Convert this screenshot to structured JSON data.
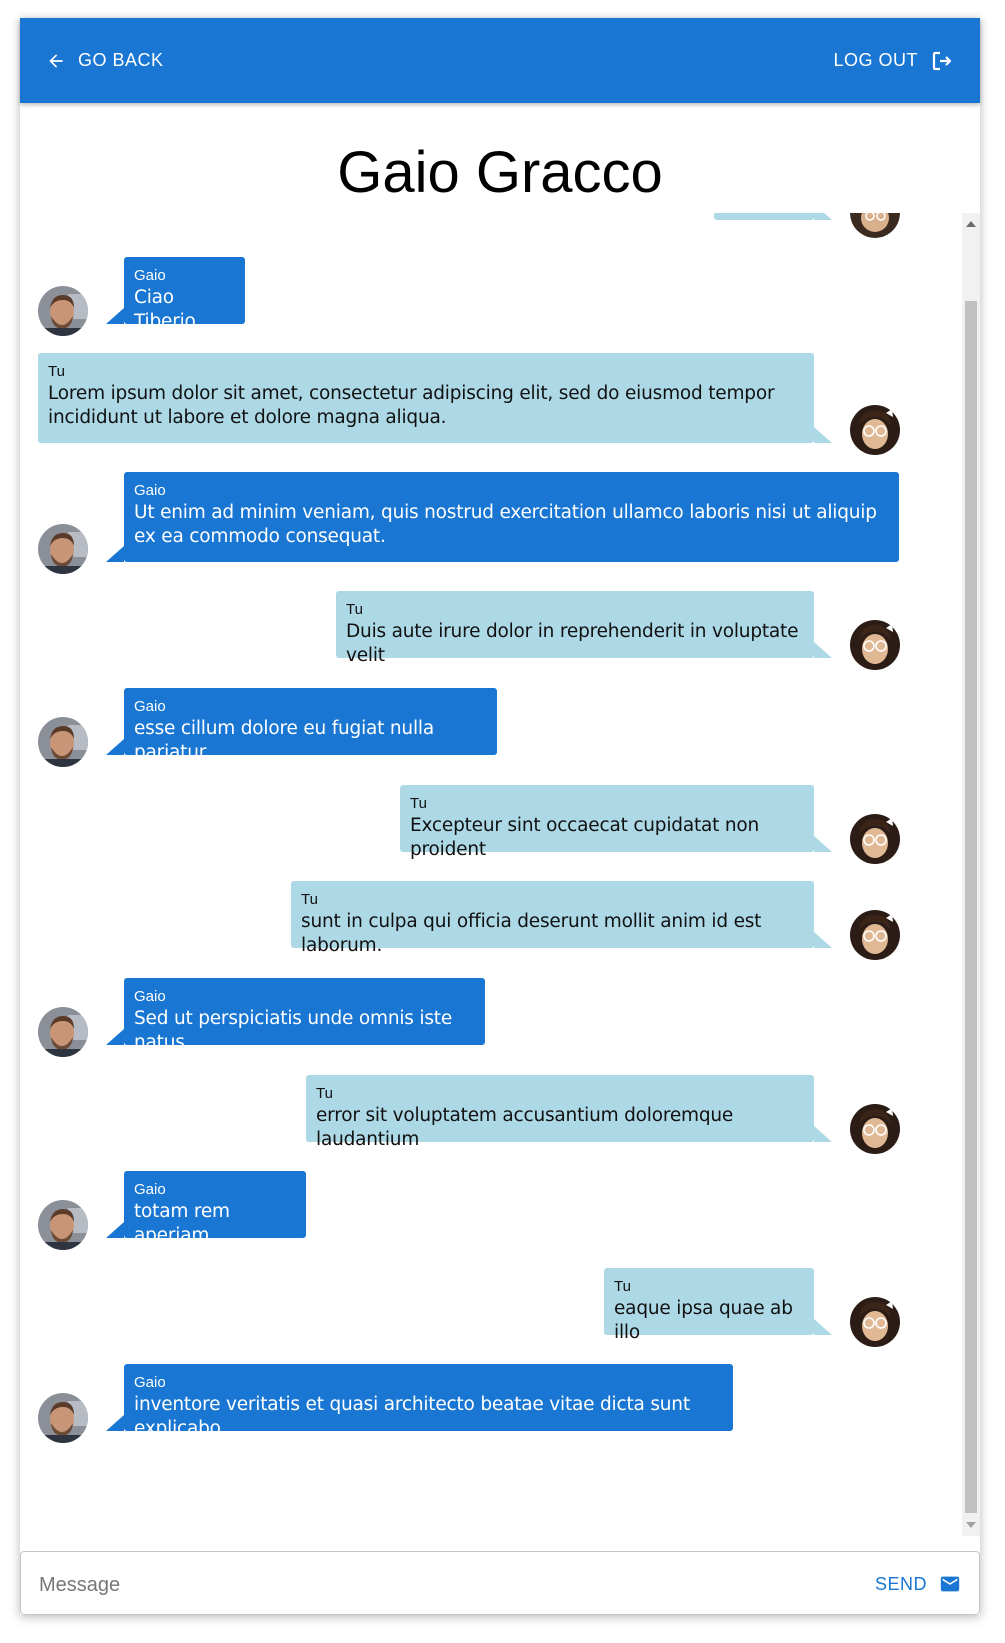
{
  "header": {
    "back_label": "GO BACK",
    "logout_label": "LOG OUT",
    "back_icon": "arrow-left-icon",
    "logout_icon": "logout-icon",
    "bar_color": "#1976d2"
  },
  "page": {
    "title": "Gaio Gracco"
  },
  "colors": {
    "their_bubble": "#1976d2",
    "my_bubble": "#add8e6"
  },
  "messages": [
    {
      "sender": "Gaio",
      "text": "Ciao Tiberio",
      "side": "theirs"
    },
    {
      "sender": "Tu",
      "text": "Lorem ipsum dolor sit amet, consectetur adipiscing elit, sed do eiusmod tempor incididunt ut labore et dolore magna aliqua.",
      "side": "mine"
    },
    {
      "sender": "Gaio",
      "text": "Ut enim ad minim veniam, quis nostrud exercitation ullamco laboris nisi ut aliquip ex ea commodo consequat.",
      "side": "theirs"
    },
    {
      "sender": "Tu",
      "text": "Duis aute irure dolor in reprehenderit in voluptate velit",
      "side": "mine"
    },
    {
      "sender": "Gaio",
      "text": "esse cillum dolore eu fugiat nulla pariatur.",
      "side": "theirs"
    },
    {
      "sender": "Tu",
      "text": "Excepteur sint occaecat cupidatat non proident",
      "side": "mine"
    },
    {
      "sender": "Tu",
      "text": "sunt in culpa qui officia deserunt mollit anim id est laborum.",
      "side": "mine"
    },
    {
      "sender": "Gaio",
      "text": "Sed ut perspiciatis unde omnis iste natus",
      "side": "theirs"
    },
    {
      "sender": "Tu",
      "text": "error sit voluptatem accusantium doloremque laudantium",
      "side": "mine"
    },
    {
      "sender": "Gaio",
      "text": "totam rem aperiam",
      "side": "theirs"
    },
    {
      "sender": "Tu",
      "text": "eaque ipsa quae ab illo",
      "side": "mine"
    },
    {
      "sender": "Gaio",
      "text": "inventore veritatis et quasi architecto beatae vitae dicta sunt explicabo",
      "side": "theirs"
    }
  ],
  "composer": {
    "placeholder": "Message",
    "value": "",
    "send_label": "SEND",
    "send_icon": "send-mail-icon"
  }
}
